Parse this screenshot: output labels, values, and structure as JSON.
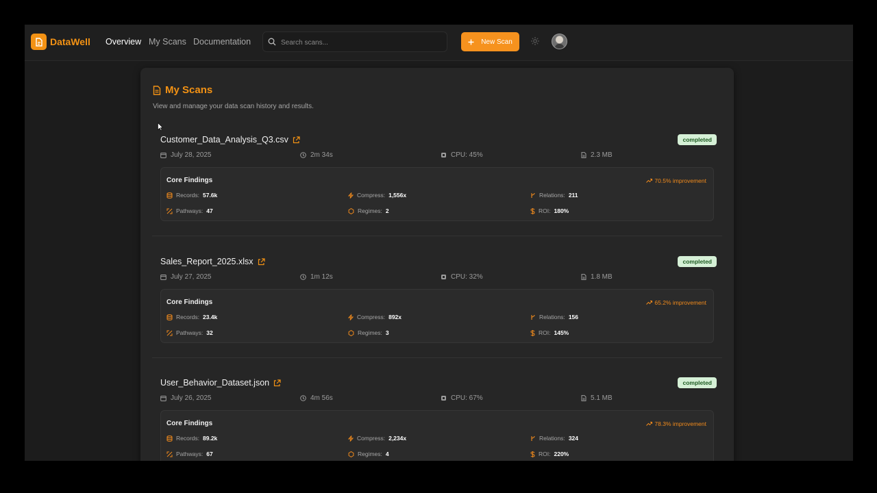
{
  "app": {
    "brand": "DataWell",
    "nav": [
      "Overview",
      "My Scans",
      "Documentation"
    ],
    "active_nav": "Overview"
  },
  "search": {
    "placeholder": "Search scans..."
  },
  "toolbar": {
    "new_scan_label": "New Scan"
  },
  "colors": {
    "accent": "#f39214",
    "status_bg": "#d5f0d6",
    "status_text": "#1d5a21"
  },
  "icons": {
    "logo": "document-logo-icon",
    "search": "search-icon",
    "new_scan": "plus-icon",
    "settings": "gear-icon",
    "title": "document-icon",
    "external": "external-link-icon",
    "date": "calendar-icon",
    "duration": "clock-icon",
    "cpu": "cpu-icon",
    "size": "file-icon",
    "improvement": "trending-up-icon"
  },
  "page": {
    "title": "My Scans",
    "subtitle": "View and manage your data scan history and results."
  },
  "scans": [
    {
      "name": "Customer_Data_Analysis_Q3.csv",
      "status": "completed",
      "date": "July 28, 2025",
      "duration": "2m 34s",
      "cpu": "CPU: 45%",
      "size": "2.3 MB",
      "findings_title": "Core Findings",
      "improvement": "70.5% improvement",
      "records_label": "Records:",
      "records": "57.6k",
      "compress_label": "Compress:",
      "compress": "1,556x",
      "relations_label": "Relations:",
      "relations": "211",
      "pathways_label": "Pathways:",
      "pathways": "47",
      "regimes_label": "Regimes:",
      "regimes": "2",
      "roi_label": "ROI:",
      "roi": "180%"
    },
    {
      "name": "Sales_Report_2025.xlsx",
      "status": "completed",
      "date": "July 27, 2025",
      "duration": "1m 12s",
      "cpu": "CPU: 32%",
      "size": "1.8 MB",
      "findings_title": "Core Findings",
      "improvement": "65.2% improvement",
      "records_label": "Records:",
      "records": "23.4k",
      "compress_label": "Compress:",
      "compress": "892x",
      "relations_label": "Relations:",
      "relations": "156",
      "pathways_label": "Pathways:",
      "pathways": "32",
      "regimes_label": "Regimes:",
      "regimes": "3",
      "roi_label": "ROI:",
      "roi": "145%"
    },
    {
      "name": "User_Behavior_Dataset.json",
      "status": "completed",
      "date": "July 26, 2025",
      "duration": "4m 56s",
      "cpu": "CPU: 67%",
      "size": "5.1 MB",
      "findings_title": "Core Findings",
      "improvement": "78.3% improvement",
      "records_label": "Records:",
      "records": "89.2k",
      "compress_label": "Compress:",
      "compress": "2,234x",
      "relations_label": "Relations:",
      "relations": "324",
      "pathways_label": "Pathways:",
      "pathways": "67",
      "regimes_label": "Regimes:",
      "regimes": "4",
      "roi_label": "ROI:",
      "roi": "220%"
    }
  ]
}
